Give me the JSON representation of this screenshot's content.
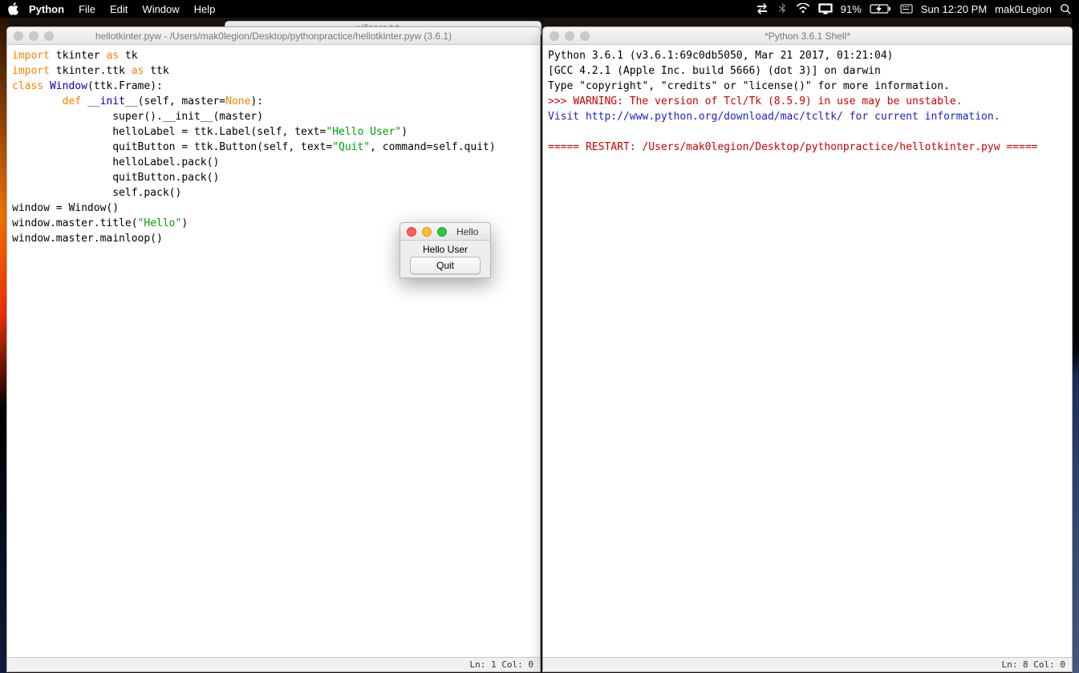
{
  "menubar": {
    "app_name": "Python",
    "menus": [
      "File",
      "Edit",
      "Window",
      "Help"
    ],
    "battery_pct": "91%",
    "clock": "Sun 12:20 PM",
    "user": "mak0Legion"
  },
  "bg_tab": {
    "title": "wifipass.txt —"
  },
  "editor_window": {
    "title": "hellotkinter.pyw - /Users/mak0legion/Desktop/pythonpractice/hellotkinter.pyw (3.6.1)",
    "status": "Ln: 1   Col: 0",
    "code": {
      "l0": {
        "a": "import",
        "b": " tkinter ",
        "c": "as",
        "d": " tk"
      },
      "l1": {
        "a": "import",
        "b": " tkinter.ttk ",
        "c": "as",
        "d": " ttk"
      },
      "l2": {
        "a": "class ",
        "b": "Window",
        "c": "(ttk.Frame):"
      },
      "l3": {
        "a": "        ",
        "b": "def ",
        "c": "__init__",
        "d": "(self, master=",
        "e": "None",
        "f": "):"
      },
      "l4": "                super().__init__(master)",
      "l5": {
        "a": "                helloLabel = ttk.Label(self, text=",
        "b": "\"Hello User\"",
        "c": ")"
      },
      "l6": {
        "a": "                quitButton = ttk.Button(self, text=",
        "b": "\"Quit\"",
        "c": ", command=self.quit)"
      },
      "l7": "                helloLabel.pack()",
      "l8": "                quitButton.pack()",
      "l9": "                self.pack()",
      "l10": "window = Window()",
      "l11": {
        "a": "window.master.title(",
        "b": "\"Hello\"",
        "c": ")"
      },
      "l12": "window.master.mainloop()"
    }
  },
  "shell_window": {
    "title": "*Python 3.6.1 Shell*",
    "status": "Ln: 8   Col: 0",
    "lines": {
      "l0": "Python 3.6.1 (v3.6.1:69c0db5050, Mar 21 2017, 01:21:04)",
      "l1": "[GCC 4.2.1 (Apple Inc. build 5666) (dot 3)] on darwin",
      "l2": "Type \"copyright\", \"credits\" or \"license()\" for more information.",
      "l3_prompt": ">>> ",
      "l3_warn": "WARNING: The version of Tcl/Tk (8.5.9) in use may be unstable.",
      "l4a": "Visit ",
      "l4_link": "http://www.python.org/download/mac/tcltk/",
      "l4b": " for current information.",
      "l5": "",
      "l6": "===== RESTART: /Users/mak0legion/Desktop/pythonpractice/hellotkinter.pyw ====="
    }
  },
  "tk_popup": {
    "title": "Hello",
    "label": "Hello User",
    "button": "Quit"
  }
}
